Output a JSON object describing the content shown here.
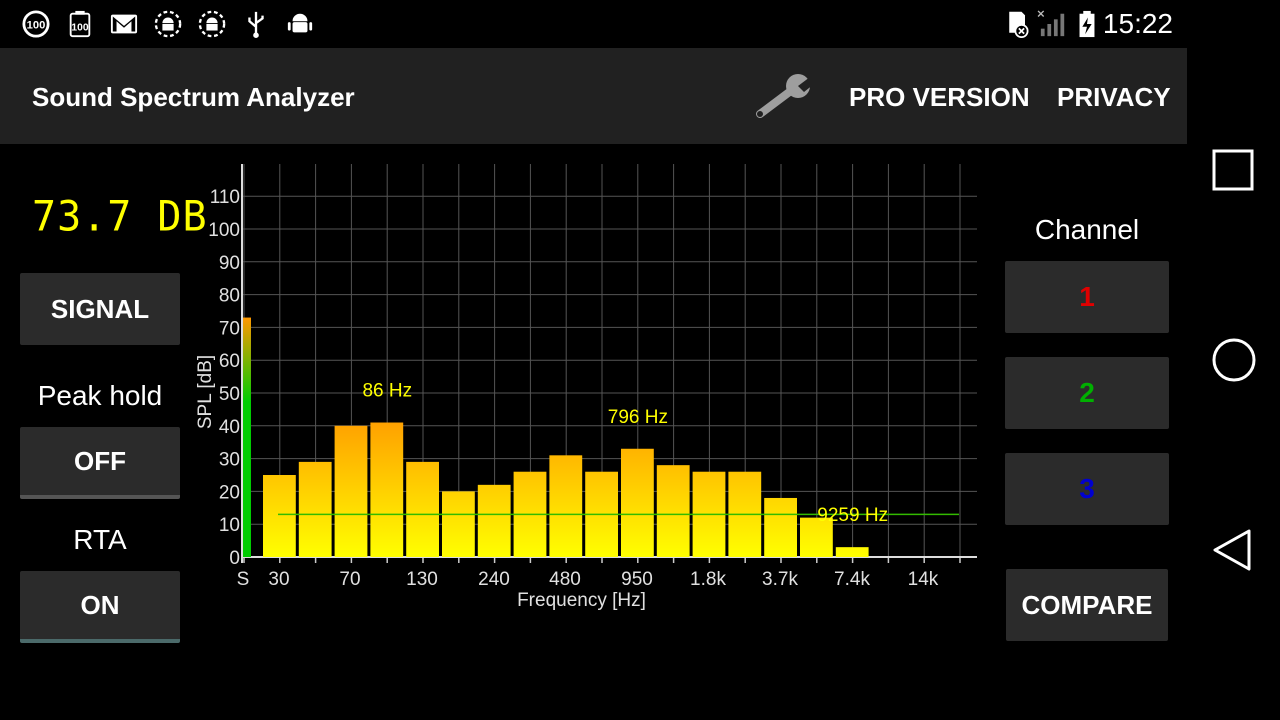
{
  "status_bar": {
    "icons": [
      "battery-100-icon",
      "battery-100-outline-icon",
      "gmail-icon",
      "android-debug-icon",
      "android-debug-icon",
      "usb-icon",
      "android-icon"
    ],
    "right_icons": [
      "sd-card-error-icon",
      "signal-none-icon",
      "battery-charging-icon"
    ],
    "time": "15:22"
  },
  "app_bar": {
    "title": "Sound Spectrum Analyzer",
    "settings_icon": "wrench-icon",
    "pro_label": "PRO VERSION",
    "privacy_label": "PRIVACY"
  },
  "left_panel": {
    "level_readout": "73.7 DB",
    "signal_label": "SIGNAL",
    "peak_hold_label": "Peak hold",
    "peak_hold_value": "OFF",
    "rta_label": "RTA",
    "rta_value": "ON"
  },
  "right_panel": {
    "channel_label": "Channel",
    "channels": [
      {
        "label": "1",
        "color": "#e00000"
      },
      {
        "label": "2",
        "color": "#00b000"
      },
      {
        "label": "3",
        "color": "#0000d0"
      }
    ],
    "compare_label": "COMPARE"
  },
  "chart_data": {
    "type": "bar",
    "xlabel": "Frequency [Hz]",
    "ylabel": "SPL [dB]",
    "ylim": [
      0,
      110
    ],
    "y_ticks": [
      "0",
      "10",
      "20",
      "30",
      "40",
      "50",
      "60",
      "70",
      "80",
      "90",
      "100",
      "110"
    ],
    "x_tick_labels": [
      "S",
      "30",
      "70",
      "130",
      "240",
      "480",
      "950",
      "1.8k",
      "3.7k",
      "7.4k",
      "14k"
    ],
    "signal_level": 73,
    "values": [
      25,
      29,
      40,
      41,
      29,
      20,
      22,
      26,
      31,
      26,
      33,
      28,
      26,
      26,
      18,
      12,
      3
    ],
    "threshold": 13,
    "peak_annotations": [
      {
        "label": "86 Hz",
        "bar_index": 3
      },
      {
        "label": "796 Hz",
        "bar_index": 10
      },
      {
        "label": "9259 Hz",
        "bar_index": 16
      }
    ],
    "grid": true,
    "colors": {
      "bar_top": "#ff9800",
      "bar_bottom": "#ffff00",
      "signal_bar": "#00cc00",
      "threshold_line": "#33bb00",
      "annotation": "#ffff00",
      "grid": "#555555"
    }
  }
}
